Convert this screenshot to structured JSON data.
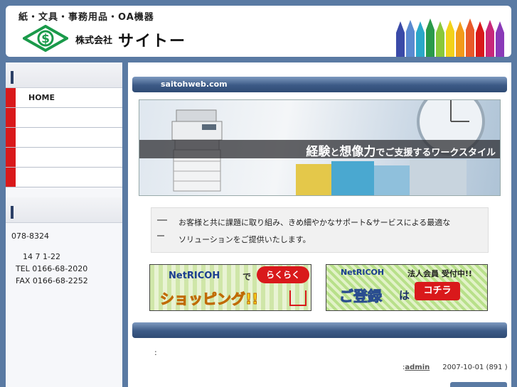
{
  "header": {
    "tagline": "紙・文具・事務用品・OA機器",
    "company_prefix": "株式会社",
    "company_name": "サイトー"
  },
  "sidebar": {
    "nav": [
      {
        "label": "HOME"
      },
      {
        "label": ""
      },
      {
        "label": ""
      },
      {
        "label": ""
      },
      {
        "label": ""
      }
    ],
    "contact": {
      "postal": "078-8324",
      "address": "14 7 1-22",
      "tel": "TEL 0166-68-2020",
      "fax": "FAX 0166-68-2252"
    }
  },
  "main": {
    "site_title": "saitohweb.com",
    "banner": {
      "emph1": "経験",
      "and": "と",
      "emph2": "想像力",
      "rest": "でご支援するワークスタイル"
    },
    "message": {
      "line1": "お客様と共に課題に取り組み、きめ細やかなサポート&サービスによる最適な",
      "line2": "ソリューションをご提供いたします。"
    },
    "ad_shopping": {
      "brand": "NetRICOH",
      "de": "で",
      "pill": "らくらく",
      "shopping": "ショッピング!!"
    },
    "ad_register": {
      "brand": "NetRICOH",
      "member": "法人会員 受付中!!",
      "register": "ご登録",
      "wa": "は",
      "kochira": "コチラ"
    },
    "post": {
      "colon": ":",
      "author_prefix": ":",
      "author": "admin",
      "date": "2007-10-01 (891",
      "date_suffix": ")"
    }
  },
  "colors": {
    "background": "#5a7aa3",
    "nav_marker": "#d9191b",
    "bar_blue": "#3c5a86"
  }
}
